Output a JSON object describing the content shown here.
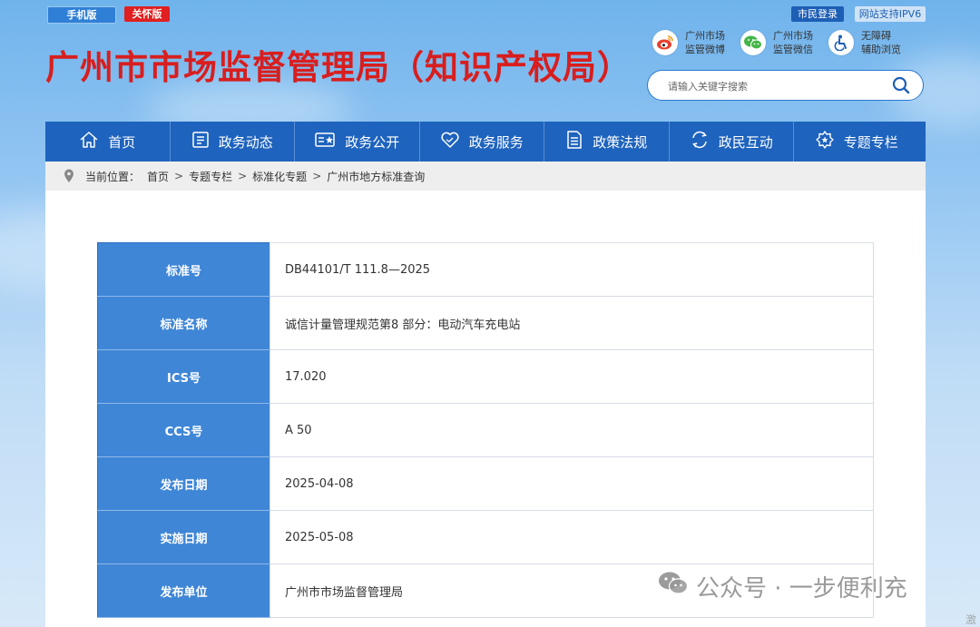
{
  "top_bar": {
    "mobile_label": "手机版",
    "care_label": "关怀版",
    "login_label": "市民登录",
    "ipv6_label": "网站支持IPV6"
  },
  "header": {
    "title": "广州市市场监督管理局（知识产权局）",
    "social": [
      {
        "line1": "广州市场",
        "line2": "监管微博",
        "icon": "weibo-icon"
      },
      {
        "line1": "广州市场",
        "line2": "监管微信",
        "icon": "wechat-icon"
      },
      {
        "line1": "无障碍",
        "line2": "辅助浏览",
        "icon": "accessibility-icon"
      }
    ],
    "search": {
      "placeholder": "请输入关键字搜索",
      "value": ""
    }
  },
  "nav": [
    {
      "label": "首页",
      "icon": "home-icon"
    },
    {
      "label": "政务动态",
      "icon": "news-icon"
    },
    {
      "label": "政务公开",
      "icon": "publicity-icon"
    },
    {
      "label": "政务服务",
      "icon": "service-icon"
    },
    {
      "label": "政策法规",
      "icon": "document-icon"
    },
    {
      "label": "政民互动",
      "icon": "interaction-icon"
    },
    {
      "label": "专题专栏",
      "icon": "special-topic-icon"
    }
  ],
  "breadcrumb": {
    "prefix": "当前位置：",
    "items": [
      "首页",
      "专题专栏",
      "标准化专题",
      "广州市地方标准查询"
    ],
    "separator": ">"
  },
  "standard": {
    "rows": [
      {
        "key": "标准号",
        "value": "DB44101/T 111.8—2025"
      },
      {
        "key": "标准名称",
        "value": "诚信计量管理规范第8 部分：电动汽车充电站"
      },
      {
        "key": "ICS号",
        "value": "17.020"
      },
      {
        "key": "CCS号",
        "value": "A 50"
      },
      {
        "key": "发布日期",
        "value": "2025-04-08"
      },
      {
        "key": "实施日期",
        "value": "2025-05-08"
      },
      {
        "key": "发布单位",
        "value": "广州市市场监督管理局"
      }
    ]
  },
  "watermark": {
    "text": "公众号 · 一步便利充",
    "corner": "激"
  },
  "colors": {
    "brand_blue": "#1e63bd",
    "title_red": "#d81e1e",
    "table_key_bg": "#3f86d7"
  }
}
